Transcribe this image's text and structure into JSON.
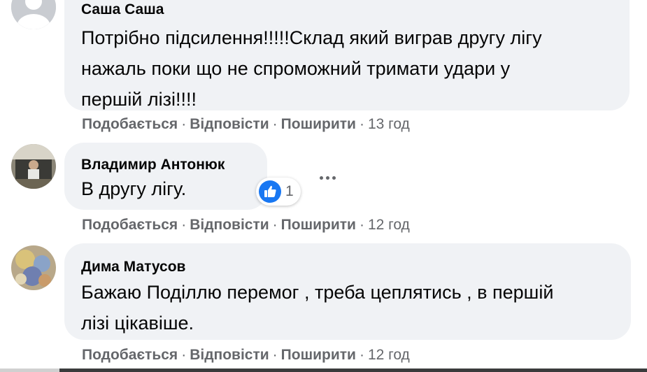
{
  "comments": [
    {
      "author": "Саша Саша",
      "lines": [
        "Потрібно підсилення!!!!!Склад який виграв другу лігу",
        "нажаль поки що не спроможний тримати удари у",
        "першій лізі!!!!"
      ],
      "actions": {
        "like": "Подобається",
        "reply": "Відповісти",
        "share": "Поширити",
        "time": "13 год"
      }
    },
    {
      "author": "Владимир Антонюк",
      "lines": [
        "В другу лігу."
      ],
      "reaction_count": "1",
      "actions": {
        "like": "Подобається",
        "reply": "Відповісти",
        "share": "Поширити",
        "time": "12 год"
      }
    },
    {
      "author": "Дима Матусов",
      "lines": [
        "Бажаю Поділлю перемог , треба цеплятись , в першій",
        "лізі цікавіше."
      ],
      "actions": {
        "like": "Подобається",
        "reply": "Відповісти",
        "share": "Поширити",
        "time": "12 год"
      }
    }
  ],
  "icons": {
    "like_reaction": "thumbs-up-icon",
    "more": "more-options-icon"
  },
  "colors": {
    "bubble": "#f0f2f5",
    "secondary_text": "#65676b",
    "like_blue": "#1877f2"
  }
}
